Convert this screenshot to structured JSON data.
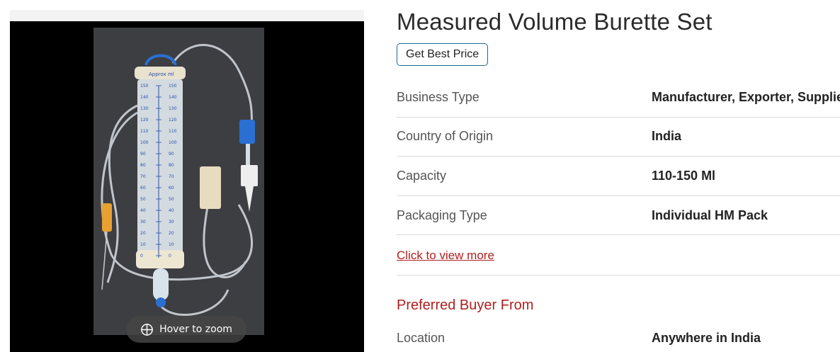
{
  "product": {
    "title": "Measured Volume Burette Set",
    "price_button": "Get Best Price"
  },
  "gallery": {
    "zoom_hint": "Hover to zoom",
    "burette_header": "Approx ml",
    "scale_left": [
      "150",
      "140",
      "130",
      "120",
      "110",
      "100",
      "90",
      "80",
      "70",
      "60",
      "50",
      "40",
      "30",
      "20",
      "10",
      "0"
    ],
    "scale_right": [
      "150",
      "140",
      "130",
      "120",
      "110",
      "100",
      "90",
      "80",
      "70",
      "60",
      "50",
      "40",
      "30",
      "20",
      "10",
      "0"
    ]
  },
  "specs": [
    {
      "label": "Business Type",
      "value": "Manufacturer, Exporter, Supplier"
    },
    {
      "label": "Country of Origin",
      "value": "India"
    },
    {
      "label": "Capacity",
      "value": "110-150 Ml"
    },
    {
      "label": "Packaging Type",
      "value": "Individual HM Pack"
    }
  ],
  "more_link": "Click to view more",
  "preferred_buyer": {
    "heading": "Preferred Buyer From",
    "location_label": "Location",
    "location_value": "Anywhere in India"
  },
  "colors": {
    "accent_red": "#b02020",
    "button_border": "#1b6b8f",
    "clamp_blue": "#2a6fd1",
    "connector_orange": "#e8a030"
  }
}
